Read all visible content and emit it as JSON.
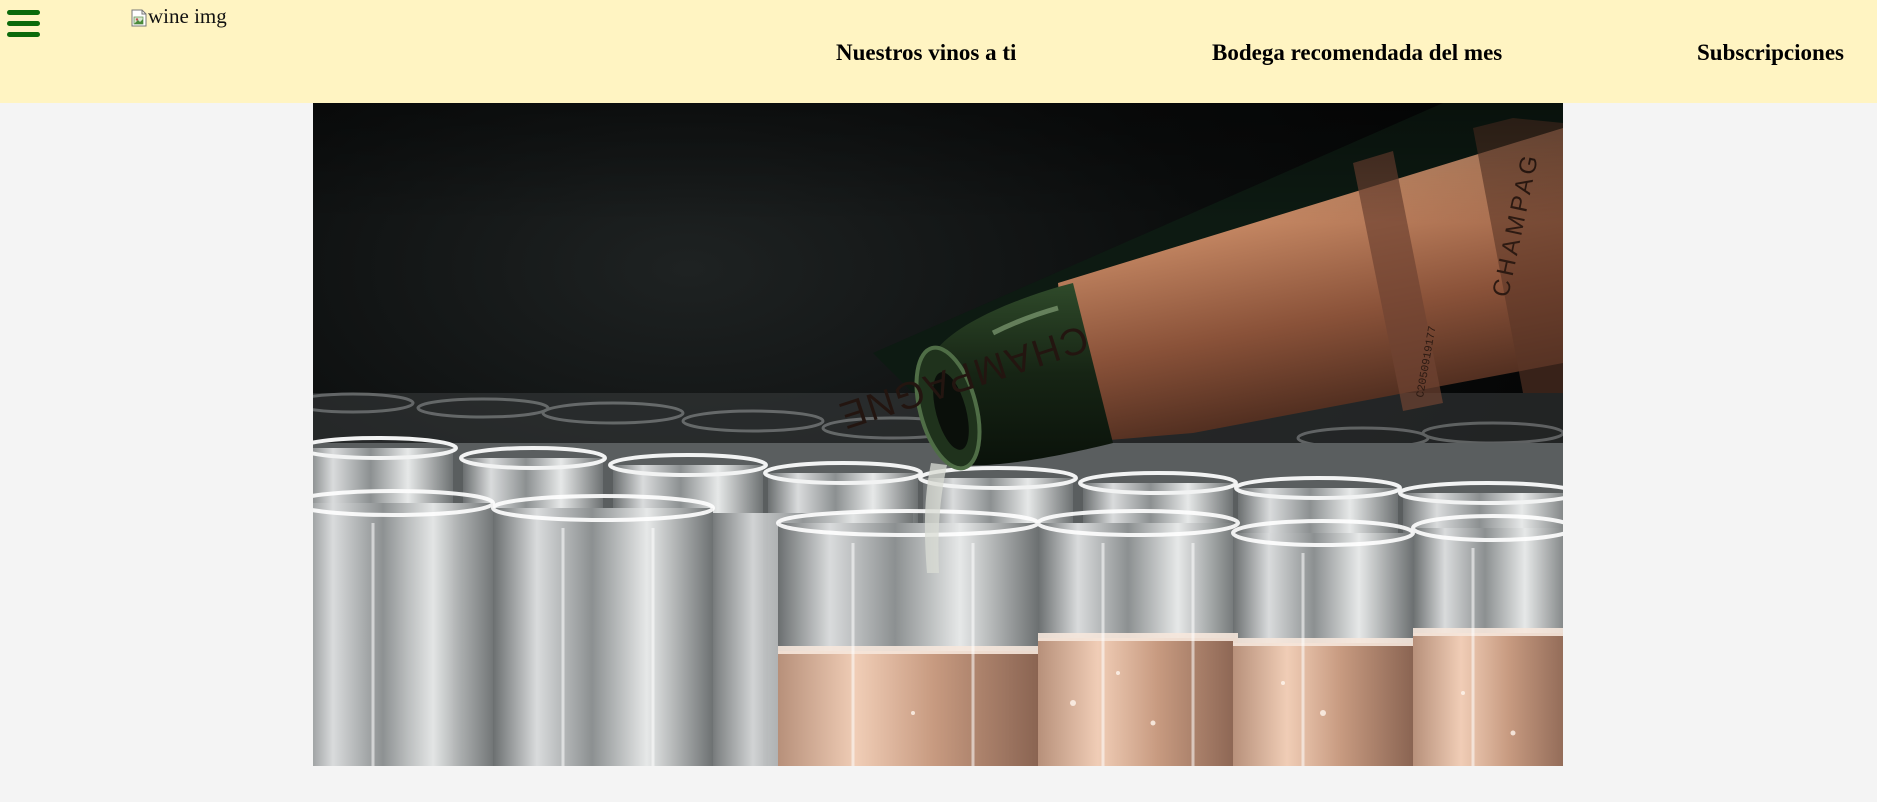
{
  "header": {
    "menu_icon": "hamburger-menu-icon",
    "logo_alt": "wine img",
    "logo_icon": "broken-image-icon",
    "nav": [
      {
        "label": "Nuestros vinos a ti"
      },
      {
        "label": "Bodega recomendada del mes"
      },
      {
        "label": "Subscripciones"
      }
    ]
  },
  "hero": {
    "bottle_label": "CHAMPAGNE",
    "bottle_label_secondary": "CHAMPAG",
    "bottle_code": "C2050919177"
  },
  "colors": {
    "header_bg": "#fff4c2",
    "menu_icon": "#0b6a0b",
    "page_bg": "#f4f4f4"
  }
}
